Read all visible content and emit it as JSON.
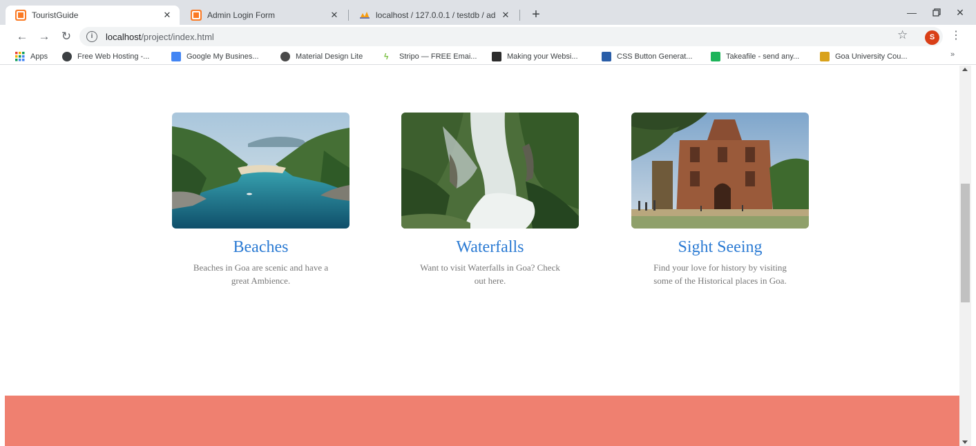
{
  "browser": {
    "tabs": [
      {
        "title": "TouristGuide",
        "favicon": "xampp-icon",
        "active": true
      },
      {
        "title": "Admin Login Form",
        "favicon": "xampp-icon",
        "active": false
      },
      {
        "title": "localhost / 127.0.0.1 / testdb / ad",
        "favicon": "phpmyadmin-icon",
        "active": false
      }
    ],
    "url_host": "localhost",
    "url_path": "/project/index.html",
    "profile_initial": "S",
    "bookmarks": [
      {
        "label": "Apps",
        "icon": "apps-grid-icon"
      },
      {
        "label": "Free Web Hosting -...",
        "icon": "globe-icon"
      },
      {
        "label": "Google My Busines...",
        "icon": "google-my-business-icon"
      },
      {
        "label": "Material Design Lite",
        "icon": "material-design-icon"
      },
      {
        "label": "Stripo — FREE Emai...",
        "icon": "stripo-icon"
      },
      {
        "label": "Making your Websi...",
        "icon": "ih-icon"
      },
      {
        "label": "CSS Button Generat...",
        "icon": "css-button-icon"
      },
      {
        "label": "Takeafile - send any...",
        "icon": "takeafile-icon"
      },
      {
        "label": "Goa University Cou...",
        "icon": "goa-university-icon"
      }
    ],
    "bookmarks_more": "»"
  },
  "page": {
    "cards": [
      {
        "title": "Beaches",
        "text": "Beaches in Goa are scenic and have a great Ambience.",
        "image": "beach-photo"
      },
      {
        "title": "Waterfalls",
        "text": "Want to visit Waterfalls in Goa? Check out here.",
        "image": "waterfall-photo"
      },
      {
        "title": "Sight Seeing",
        "text": "Find your love for history by visiting some of the Historical places in Goa.",
        "image": "church-photo"
      }
    ],
    "footer_color": "#ef8070",
    "accent_color": "#2a7ad3"
  }
}
